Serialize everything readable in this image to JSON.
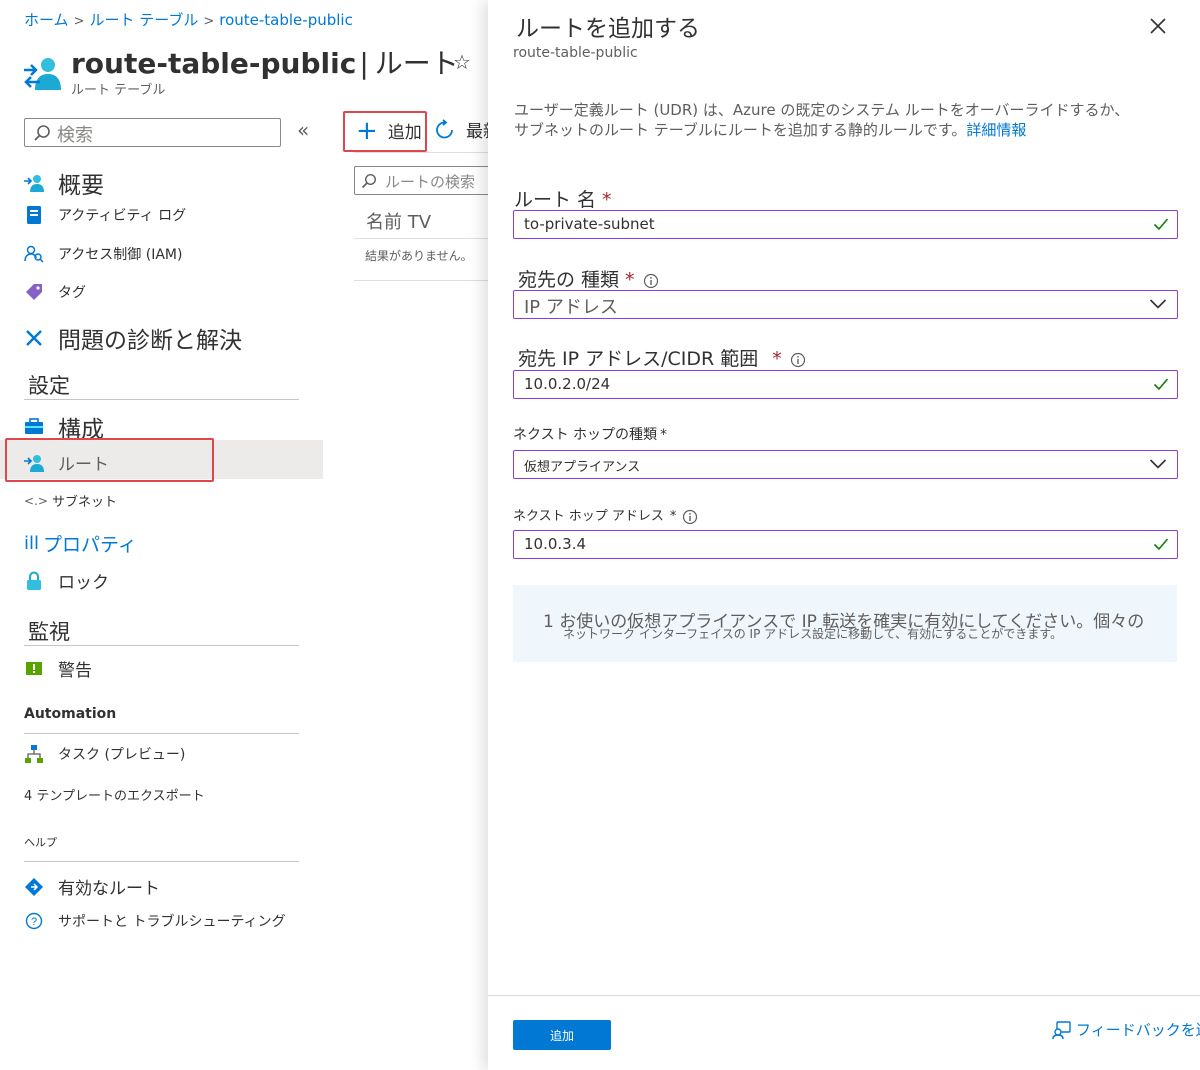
{
  "breadcrumb": {
    "items": [
      "ホーム",
      "ルート テーブル",
      "route-table-public"
    ],
    "separator": ">"
  },
  "header": {
    "resource_name": "route-table-public",
    "separator": "|",
    "page_name": "ルート",
    "resource_type": "ルート テーブル",
    "star": "☆"
  },
  "sidebar": {
    "search_placeholder": "検索",
    "collapse": "«",
    "items": {
      "overview": "概要",
      "activity_log": "アクティビティ ログ",
      "iam": "アクセス制御 (IAM)",
      "tags": "タグ",
      "diagnose": "問題の診断と解決",
      "settings_section": "設定",
      "configuration": "構成",
      "routes": "ルート",
      "subnets": "サブネット",
      "properties": "プロパティ",
      "locks": "ロック",
      "monitoring_section": "監視",
      "alerts": "警告",
      "automation_section": "Automation",
      "tasks": "タスク (プレビュー)",
      "export_template": "4 テンプレートのエクスポート",
      "help_section": "ヘルプ",
      "effective_routes": "有効なルート",
      "support": "サポートと トラブルシューティング"
    }
  },
  "routes_list": {
    "add_label": "追加",
    "refresh_label": "最新",
    "search_placeholder": "ルートの検索",
    "column_header": "名前 TV",
    "empty_message": "結果がありません。"
  },
  "panel": {
    "title": "ルートを追加する",
    "subtitle": "route-table-public",
    "description_line1": "ユーザー定義ルート (UDR) は、Azure の既定のシステム ルートをオーバーライドするか、",
    "description_line2": "サブネットのルート テーブルにルートを追加する静的ルールです。",
    "learn_more": "詳細情報",
    "route_name_label": "ルート 名",
    "route_name_value": "to-private-subnet",
    "destination_type_label": "宛先の 種類",
    "destination_type_value": "IP アドレス",
    "destination_cidr_label": "宛先 IP アドレス/CIDR 範囲",
    "destination_cidr_value": "10.0.2.0/24",
    "next_hop_type_label": "ネクスト ホップの種類",
    "next_hop_type_value": "仮想アプライアンス",
    "next_hop_address_label": "ネクスト ホップ アドレス",
    "next_hop_address_value": "10.0.3.4",
    "required_mark": "*",
    "info_line1": "1 お使いの仮想アプライアンスで IP 転送を確実に有効にしてください。個々の",
    "info_line2": "ネットワーク インターフェイスの IP アドレス設定に移動して、有効にすることができます。",
    "add_button": "追加",
    "feedback": "フィードバックを送る"
  },
  "colors": {
    "accent": "#0078d4",
    "highlight_box": "#e0474c",
    "field_border": "#8a3ce0",
    "valid_check": "#107c10",
    "required": "#a4262c"
  }
}
